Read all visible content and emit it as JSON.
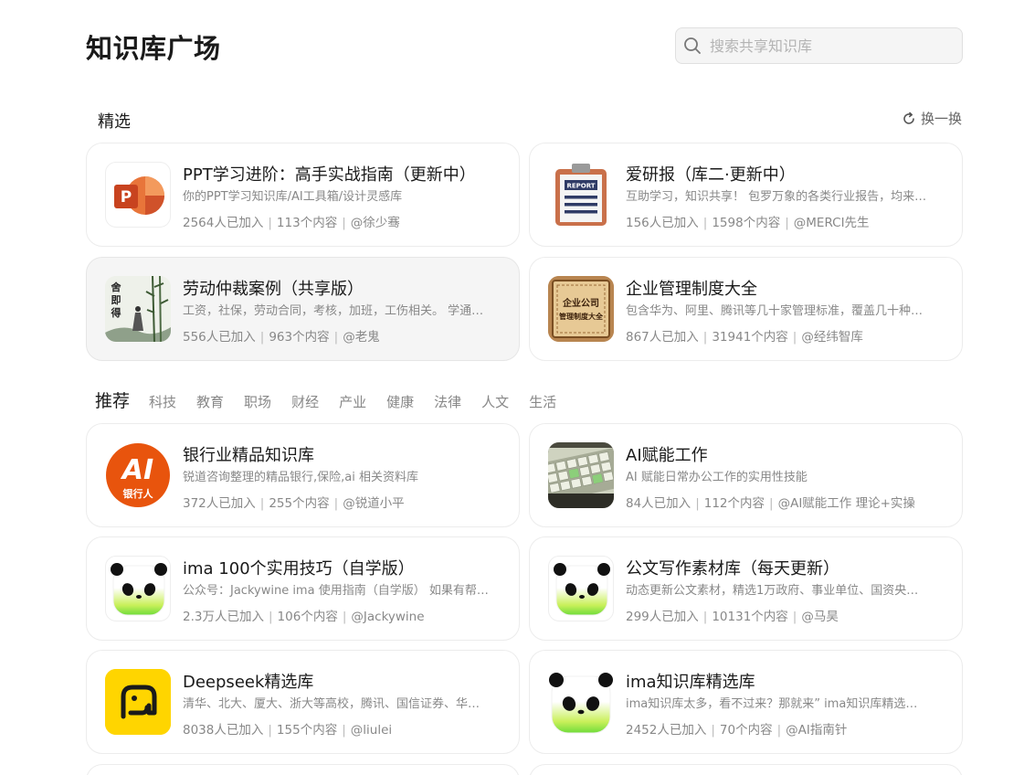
{
  "page": {
    "title": "知识库广场"
  },
  "search": {
    "placeholder": "搜索共享知识库"
  },
  "featured": {
    "label": "精选",
    "refresh_label": "换一换",
    "cards": [
      {
        "title": "PPT学习进阶：高手实战指南（更新中）",
        "desc": "你的PPT学习知识库/AI工具箱/设计灵感库",
        "members": "2564人已加入",
        "contents": "113个内容",
        "author": "@徐少骞",
        "icon": "powerpoint-icon"
      },
      {
        "title": "爱研报（库二·更新中）",
        "desc": "互助学习，知识共享！ 包罗万象的各类行业报告，均来…",
        "members": "156人已加入",
        "contents": "1598个内容",
        "author": "@MERCI先生",
        "icon": "report-clipboard-icon",
        "icon_text": "REPORT"
      },
      {
        "title": "劳动仲裁案例（共享版）",
        "desc": "工资，社保，劳动合同，考核，加班，工伤相关。 学通…",
        "members": "556人已加入",
        "contents": "963个内容",
        "author": "@老鬼",
        "icon": "ink-painting-icon",
        "icon_text": "舍即得"
      },
      {
        "title": "企业管理制度大全",
        "desc": "包含华为、阿里、腾讯等几十家管理标准，覆盖几十种…",
        "members": "867人已加入",
        "contents": "31941个内容",
        "author": "@经纬智库",
        "icon": "scroll-plaque-icon",
        "icon_text_1": "企业公司",
        "icon_text_2": "管理制度大全"
      }
    ]
  },
  "recommend": {
    "tabs": [
      "推荐",
      "科技",
      "教育",
      "职场",
      "财经",
      "产业",
      "健康",
      "法律",
      "人文",
      "生活"
    ],
    "cards": [
      {
        "title": "银行业精品知识库",
        "desc": "锐道咨询整理的精品银行,保险,ai 相关资料库",
        "members": "372人已加入",
        "contents": "255个内容",
        "author": "@锐道小平",
        "icon": "ai-bank-logo-icon",
        "icon_text_1": "AI",
        "icon_text_2": "银行人"
      },
      {
        "title": "AI赋能工作",
        "desc": "AI 赋能日常办公工作的实用性技能",
        "members": "84人已加入",
        "contents": "112个内容",
        "author": "@AI赋能工作 理论+实操",
        "icon": "keyboard-photo-icon"
      },
      {
        "title": "ima 100个实用技巧（自学版）",
        "desc": "公众号：Jackywine ima 使用指南（自学版） 如果有帮…",
        "members": "2.3万人已加入",
        "contents": "106个内容",
        "author": "@Jackywine",
        "icon": "panda-icon"
      },
      {
        "title": "公文写作素材库（每天更新）",
        "desc": "动态更新公文素材，精选1万政府、事业单位、国资央…",
        "members": "299人已加入",
        "contents": "10131个内容",
        "author": "@马昊",
        "icon": "panda-icon"
      },
      {
        "title": "Deepseek精选库",
        "desc": "清华、北大、厦大、浙大等高校，腾讯、国信证券、华…",
        "members": "8038人已加入",
        "contents": "155个内容",
        "author": "@liulei",
        "icon": "yellow-elephant-icon"
      },
      {
        "title": "ima知识库精选库",
        "desc": "ima知识库太多，看不过来？那就来” ima知识库精选…",
        "members": "2452人已加入",
        "contents": "70个内容",
        "author": "@AI指南针",
        "icon": "panda-icon"
      }
    ]
  },
  "colors": {
    "accent_orange": "#e8540d",
    "ppt_red": "#c8431f",
    "panda_green": "#7ddc3c",
    "yellow": "#ffd500"
  }
}
